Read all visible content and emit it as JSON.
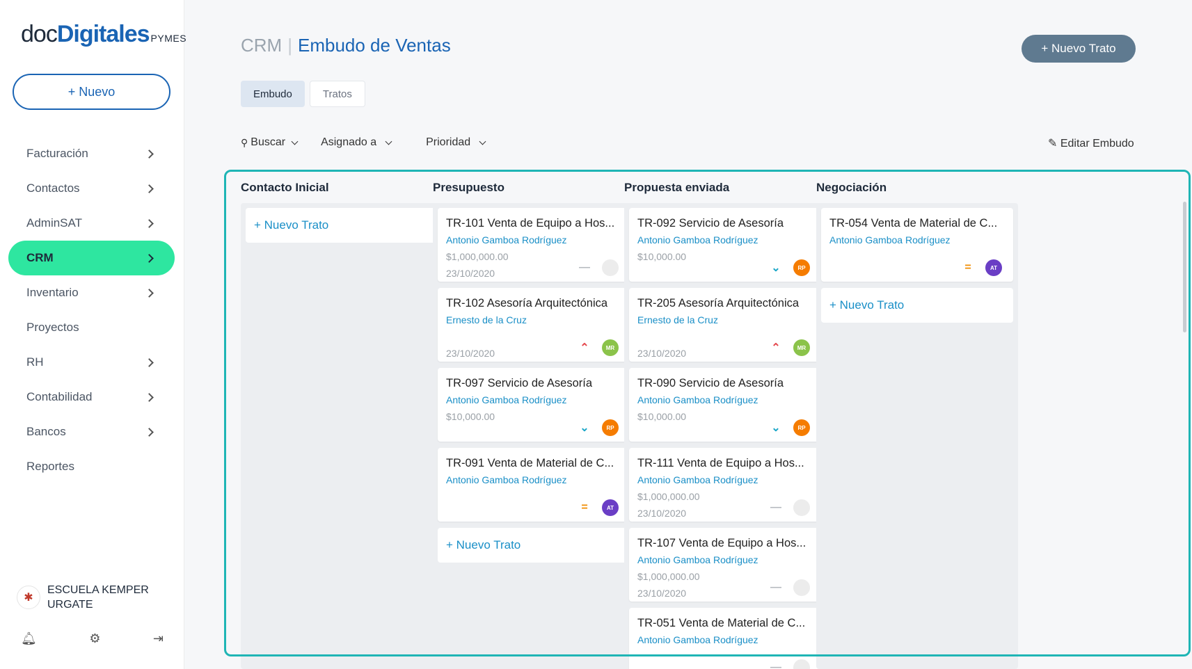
{
  "logo": {
    "doc": "doc",
    "digitales": "Digitales",
    "pymes": "PYMES"
  },
  "sidebar": {
    "new_button": "+ Nuevo",
    "items": [
      {
        "label": "Facturación",
        "chevron": true,
        "active": false
      },
      {
        "label": "Contactos",
        "chevron": true,
        "active": false
      },
      {
        "label": "AdminSAT",
        "chevron": true,
        "active": false
      },
      {
        "label": "CRM",
        "chevron": true,
        "active": true
      },
      {
        "label": "Inventario",
        "chevron": true,
        "active": false
      },
      {
        "label": "Proyectos",
        "chevron": false,
        "active": false
      },
      {
        "label": "RH",
        "chevron": true,
        "active": false
      },
      {
        "label": "Contabilidad",
        "chevron": true,
        "active": false
      },
      {
        "label": "Bancos",
        "chevron": true,
        "active": false
      },
      {
        "label": "Reportes",
        "chevron": false,
        "active": false
      }
    ],
    "company": "ESCUELA KEMPER URGATE",
    "footer_icons": [
      "bell-icon",
      "gear-icon",
      "logout-icon"
    ]
  },
  "header": {
    "breadcrumb_root": "CRM",
    "separator": "|",
    "title": "Embudo de Ventas",
    "new_deal_button": "+ Nuevo Trato"
  },
  "tabs": [
    {
      "label": "Embudo",
      "active": true
    },
    {
      "label": "Tratos",
      "active": false
    }
  ],
  "filters": {
    "search": "Buscar",
    "assigned": "Asignado a",
    "priority": "Prioridad",
    "edit_funnel": "Editar Embudo"
  },
  "colors": {
    "accent": "#1a64b4",
    "active_nav": "#2ee6a0",
    "frame": "#1fb5b5",
    "link": "#1a8fc7"
  },
  "board": {
    "add_label": "+ Nuevo Trato",
    "columns": [
      {
        "title": "Contacto Inicial",
        "cards": []
      },
      {
        "title": "Presupuesto",
        "cards": [
          {
            "title": "TR-101 Venta de Equipo a Hos...",
            "person": "Antonio Gamboa Rodríguez",
            "amount": "$1,000,000.00",
            "date": "23/10/2020",
            "priority": "none",
            "avatar": ""
          },
          {
            "title": "TR-102 Asesoría Arquitectónica",
            "person": "Ernesto de la Cruz",
            "amount": "",
            "date": "23/10/2020",
            "priority": "high",
            "avatar": "MR"
          },
          {
            "title": "TR-097 Servicio de Asesoría",
            "person": "Antonio Gamboa Rodríguez",
            "amount": "$10,000.00",
            "date": "",
            "priority": "low",
            "avatar": "RP"
          },
          {
            "title": "TR-091 Venta de Material de C...",
            "person": "Antonio Gamboa Rodríguez",
            "amount": "",
            "date": "",
            "priority": "medium",
            "avatar": "AT"
          }
        ]
      },
      {
        "title": "Propuesta enviada",
        "cards": [
          {
            "title": "TR-092 Servicio de Asesoría",
            "person": "Antonio Gamboa Rodríguez",
            "amount": "$10,000.00",
            "date": "",
            "priority": "low",
            "avatar": "RP"
          },
          {
            "title": "TR-205 Asesoría Arquitectónica",
            "person": "Ernesto de la Cruz",
            "amount": "",
            "date": "23/10/2020",
            "priority": "high",
            "avatar": "MR"
          },
          {
            "title": "TR-090 Servicio de Asesoría",
            "person": "Antonio Gamboa Rodríguez",
            "amount": "$10,000.00",
            "date": "",
            "priority": "low",
            "avatar": "RP"
          },
          {
            "title": "TR-111 Venta de Equipo a Hos...",
            "person": "Antonio Gamboa Rodríguez",
            "amount": "$1,000,000.00",
            "date": "23/10/2020",
            "priority": "none",
            "avatar": ""
          },
          {
            "title": "TR-107 Venta de Equipo a Hos...",
            "person": "Antonio Gamboa Rodríguez",
            "amount": "$1,000,000.00",
            "date": "23/10/2020",
            "priority": "none",
            "avatar": ""
          },
          {
            "title": "TR-051 Venta de Material de C...",
            "person": "Antonio Gamboa Rodríguez",
            "amount": "",
            "date": "",
            "priority": "none",
            "avatar": ""
          }
        ]
      },
      {
        "title": "Negociación",
        "cards": [
          {
            "title": "TR-054 Venta de Material de C...",
            "person": "Antonio Gamboa Rodríguez",
            "amount": "",
            "date": "",
            "priority": "medium",
            "avatar": "AT"
          }
        ]
      }
    ]
  }
}
